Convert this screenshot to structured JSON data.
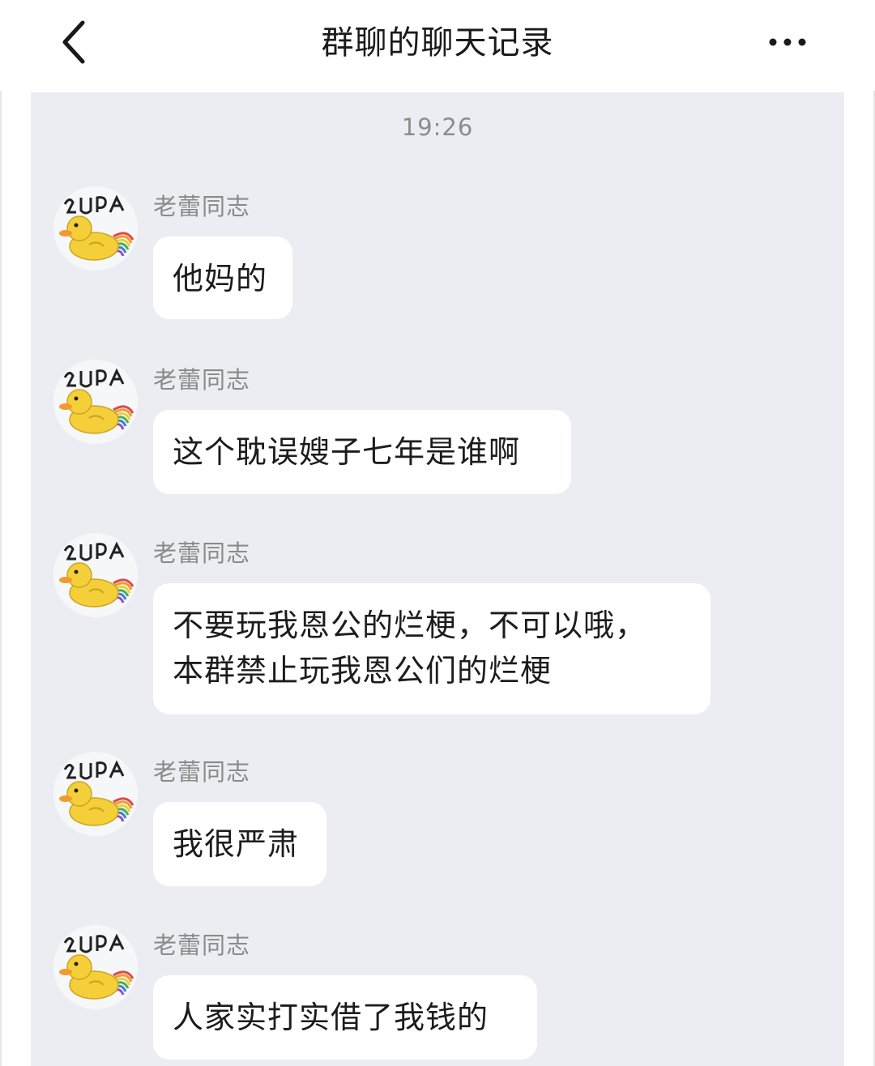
{
  "header": {
    "title": "群聊的聊天记录",
    "back_icon": "chevron-left-icon",
    "more_icon": "more-horizontal-icon"
  },
  "chat": {
    "timestamp": "19:26",
    "messages": [
      {
        "sender": "老蕾同志",
        "text": "他妈的"
      },
      {
        "sender": "老蕾同志",
        "text": "这个耽误嫂子七年是谁啊"
      },
      {
        "sender": "老蕾同志",
        "text": "不要玩我恩公的烂梗，不可以哦，\n本群禁止玩我恩公们的烂梗"
      },
      {
        "sender": "老蕾同志",
        "text": "我很严肃"
      },
      {
        "sender": "老蕾同志",
        "text": "人家实打实借了我钱的"
      }
    ],
    "avatar": {
      "icon": "rubber-duck-rainbow-avatar",
      "logo_text": "2UPA"
    }
  },
  "colors": {
    "chat_background": "#ebedf2",
    "bubble": "#ffffff",
    "duck_yellow": "#f5cf3a"
  }
}
